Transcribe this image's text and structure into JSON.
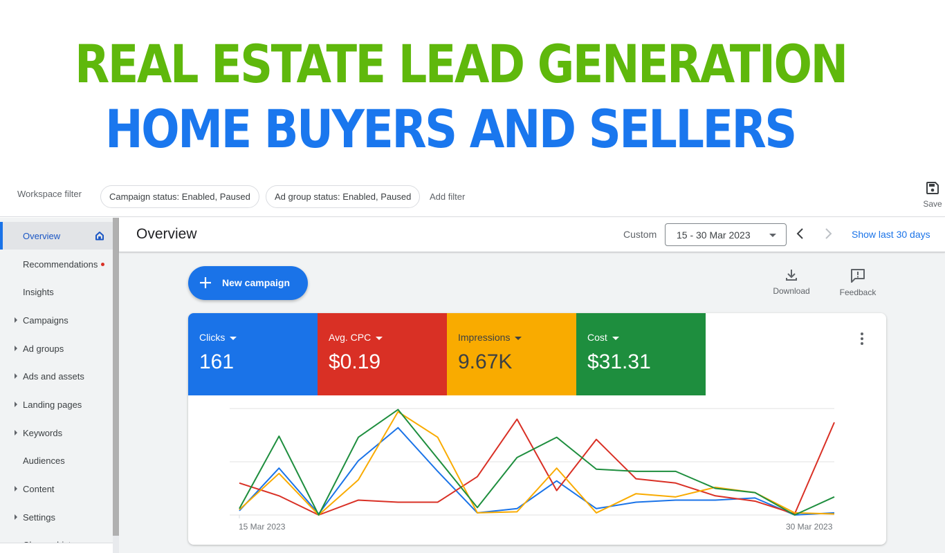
{
  "banner": {
    "line1": "REAL ESTATE LEAD GENERATION",
    "line2": "HOME BUYERS AND SELLERS",
    "line1_color": "#5fb80c",
    "line2_color": "#1a77ee"
  },
  "filter_bar": {
    "label": "Workspace filter",
    "chips": [
      "Campaign status: Enabled, Paused",
      "Ad group status: Enabled, Paused"
    ],
    "add_filter": "Add filter",
    "save_label": "Save",
    "save_icon": "save-icon"
  },
  "sidebar": {
    "items": [
      {
        "label": "Overview",
        "active": true,
        "icon": "home-icon",
        "expandable": false
      },
      {
        "label": "Recommendations",
        "badge": "red-dot",
        "expandable": false
      },
      {
        "label": "Insights",
        "expandable": false
      },
      {
        "label": "Campaigns",
        "expandable": true
      },
      {
        "label": "Ad groups",
        "expandable": true
      },
      {
        "label": "Ads and assets",
        "expandable": true
      },
      {
        "label": "Landing pages",
        "expandable": true
      },
      {
        "label": "Keywords",
        "expandable": true
      },
      {
        "label": "Audiences",
        "expandable": false
      },
      {
        "label": "Content",
        "expandable": true
      },
      {
        "label": "Settings",
        "expandable": true
      },
      {
        "label": "Change history",
        "expandable": false
      }
    ]
  },
  "header": {
    "title": "Overview",
    "date_mode": "Custom",
    "date_range": "15 - 30 Mar 2023",
    "show_last": "Show last 30 days"
  },
  "actions": {
    "new_campaign": "New campaign",
    "download": "Download",
    "feedback": "Feedback"
  },
  "metrics": [
    {
      "label": "Clicks",
      "value": "161",
      "color": "#1a73e8"
    },
    {
      "label": "Avg. CPC",
      "value": "$0.19",
      "color": "#d93025"
    },
    {
      "label": "Impressions",
      "value": "9.67K",
      "color": "#f9ab00"
    },
    {
      "label": "Cost",
      "value": "$31.31",
      "color": "#1e8e3e"
    }
  ],
  "chart_data": {
    "type": "line",
    "x": [
      "15 Mar",
      "16 Mar",
      "17 Mar",
      "18 Mar",
      "19 Mar",
      "20 Mar",
      "21 Mar",
      "22 Mar",
      "23 Mar",
      "24 Mar",
      "25 Mar",
      "26 Mar",
      "27 Mar",
      "28 Mar",
      "29 Mar",
      "30 Mar"
    ],
    "x_tick_labels": [
      "15 Mar 2023",
      "30 Mar 2023"
    ],
    "y_scale": "normalized per series (0 = baseline, 1 = top gridline)",
    "ylim": [
      0,
      1
    ],
    "gridlines": [
      0,
      0.5,
      1
    ],
    "legend": "metric tiles above chart",
    "series": [
      {
        "name": "Clicks",
        "color": "#1a73e8",
        "values": [
          0.04,
          0.44,
          0.01,
          0.51,
          0.82,
          0.41,
          0.02,
          0.06,
          0.32,
          0.06,
          0.12,
          0.14,
          0.14,
          0.16,
          0.0,
          0.02
        ]
      },
      {
        "name": "Avg. CPC",
        "color": "#d93025",
        "values": [
          0.3,
          0.18,
          0.0,
          0.14,
          0.12,
          0.12,
          0.36,
          0.9,
          0.23,
          0.71,
          0.34,
          0.3,
          0.18,
          0.13,
          0.01,
          0.87
        ]
      },
      {
        "name": "Impressions",
        "color": "#f9ab00",
        "values": [
          0.05,
          0.39,
          0.0,
          0.33,
          0.97,
          0.73,
          0.02,
          0.03,
          0.44,
          0.02,
          0.2,
          0.17,
          0.26,
          0.21,
          0.02,
          0.01
        ]
      },
      {
        "name": "Cost",
        "color": "#1e8e3e",
        "values": [
          0.06,
          0.74,
          0.0,
          0.73,
          0.99,
          0.53,
          0.07,
          0.54,
          0.73,
          0.43,
          0.41,
          0.41,
          0.25,
          0.21,
          0.0,
          0.17
        ]
      }
    ]
  }
}
